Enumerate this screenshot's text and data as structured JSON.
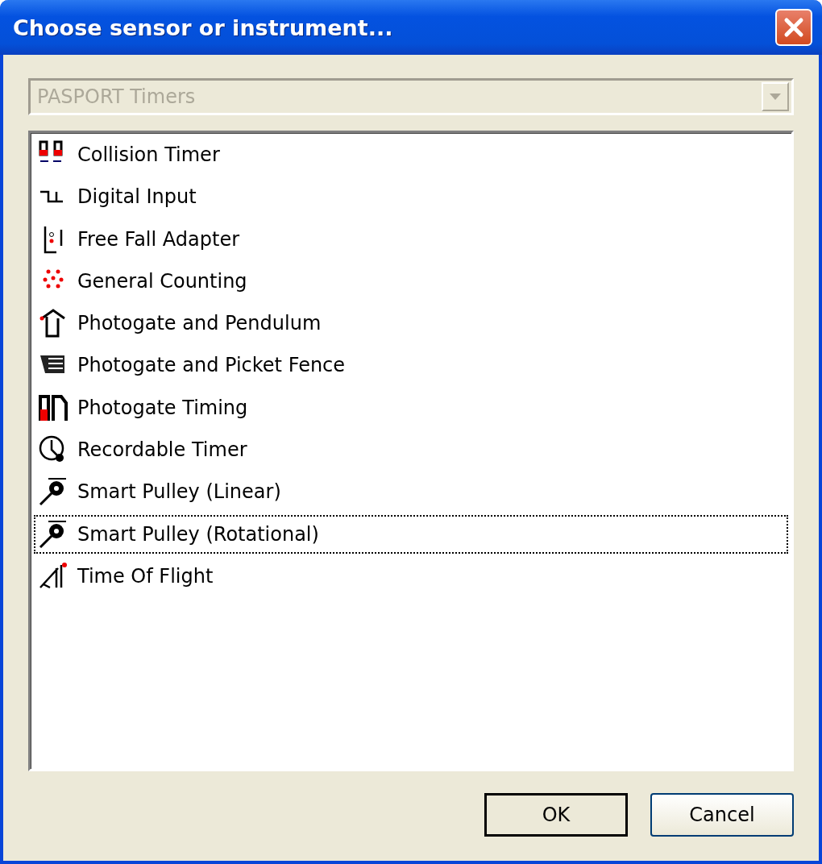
{
  "window": {
    "title": "Choose sensor or instrument..."
  },
  "category": {
    "value": "PASPORT Timers",
    "disabled": true
  },
  "items": [
    {
      "label": "Collision Timer",
      "focused": false
    },
    {
      "label": "Digital Input",
      "focused": false
    },
    {
      "label": "Free Fall Adapter",
      "focused": false
    },
    {
      "label": "General Counting",
      "focused": false
    },
    {
      "label": "Photogate and Pendulum",
      "focused": false
    },
    {
      "label": "Photogate and Picket Fence",
      "focused": false
    },
    {
      "label": "Photogate Timing",
      "focused": false
    },
    {
      "label": "Recordable Timer",
      "focused": false
    },
    {
      "label": "Smart Pulley (Linear)",
      "focused": false
    },
    {
      "label": "Smart Pulley (Rotational)",
      "focused": true
    },
    {
      "label": "Time Of Flight",
      "focused": false
    }
  ],
  "buttons": [
    "OK",
    "Cancel"
  ]
}
